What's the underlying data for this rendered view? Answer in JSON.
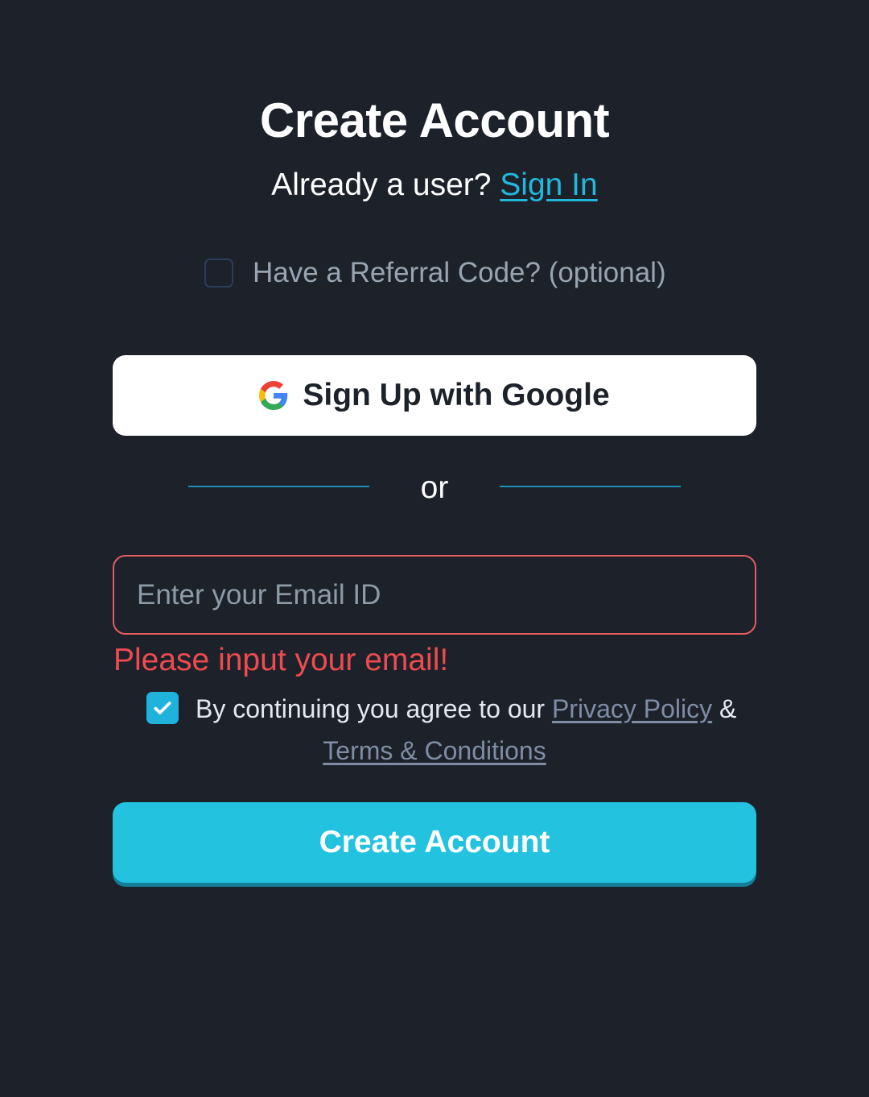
{
  "header": {
    "title": "Create Account",
    "already_text": "Already a user?",
    "sign_in_link": "Sign In"
  },
  "referral": {
    "label": "Have a Referral Code? (optional)",
    "checked": false
  },
  "google_button": {
    "label": "Sign Up with Google",
    "icon": "google-icon"
  },
  "divider": {
    "text": "or"
  },
  "email": {
    "placeholder": "Enter your Email ID",
    "value": "",
    "error": "Please input your email!"
  },
  "agreement": {
    "checked": true,
    "prefix": "By continuing you agree to our",
    "privacy_link": "Privacy Policy",
    "ampersand": "&",
    "terms_link": "Terms & Conditions"
  },
  "submit": {
    "label": "Create Account"
  },
  "colors": {
    "background": "#1d222a",
    "accent": "#23c2df",
    "link": "#22b8dc",
    "error": "#ed4b4f"
  }
}
